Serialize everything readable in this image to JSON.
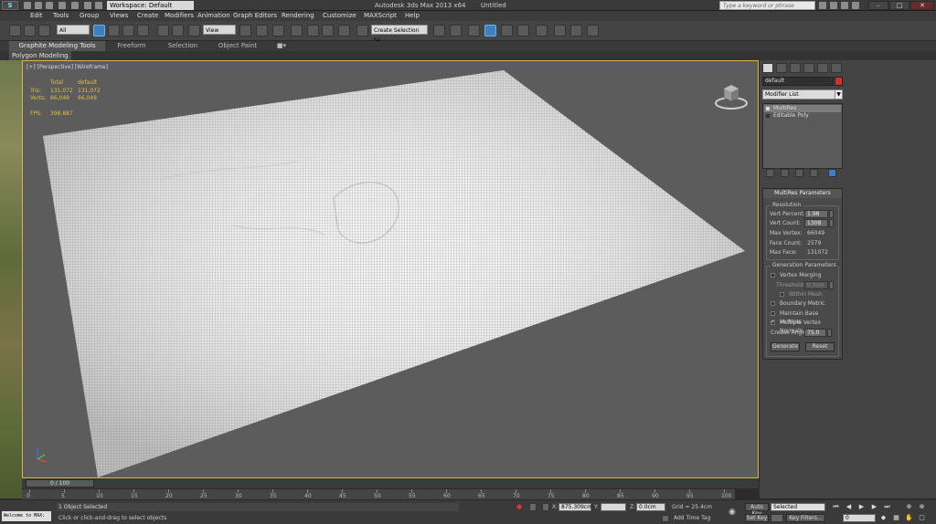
{
  "titlebar": {
    "workspace": "Workspace: Default",
    "app_title": "Autodesk 3ds Max  2013 x64",
    "doc_title": "Untitled",
    "search_placeholder": "Type a keyword or phrase",
    "logo_glyph": "S"
  },
  "menu": {
    "items": [
      "Edit",
      "Tools",
      "Group",
      "Views",
      "Create",
      "Modifiers",
      "Animation",
      "Graph Editors",
      "Rendering",
      "Customize",
      "MAXScript",
      "Help"
    ]
  },
  "toolbar": {
    "selection_filter": "All",
    "ref_coord": "View",
    "named_selection": "Create Selection Se"
  },
  "ribbon": {
    "tabs": [
      "Graphite Modeling Tools",
      "Freeform",
      "Selection",
      "Object Paint"
    ],
    "sub_tab": "Polygon Modeling"
  },
  "viewport": {
    "label": "[+] [Perspective] [Wireframe]",
    "stats": {
      "col_total": "Total",
      "col_default": "default",
      "tris_label": "Tris:",
      "tris_total": "131,072",
      "tris_default": "131,072",
      "verts_label": "Verts:",
      "verts_total": "66,049",
      "verts_default": "66,049",
      "fps_label": "FPS:",
      "fps_value": "398.887"
    }
  },
  "command_panel": {
    "object_name": "default",
    "object_color": "#d32f2f",
    "modifier_list": "Modifier List",
    "stack": [
      "MultiRes",
      "Editable Poly"
    ],
    "rollout_title": "MultiRes Parameters",
    "resolution": {
      "group": "Resolution",
      "vert_percent_label": "Vert Percent:",
      "vert_percent": "1.98",
      "vert_count_label": "Vert Count:",
      "vert_count": "1308",
      "max_vertex_label": "Max Vertex:",
      "max_vertex": "66049",
      "face_count_label": "Face Count:",
      "face_count": "2579",
      "max_face_label": "Max Face:",
      "max_face": "131072"
    },
    "generation": {
      "group": "Generation Parameters",
      "vertex_merging": "Vertex Merging",
      "threshold_label": "Threshold:",
      "threshold": "0.0cm",
      "within_mesh": "Within Mesh",
      "boundary_metric": "Boundary Metric",
      "maintain_base": "Maintain Base Vertices",
      "multiple_normals": "Multiple Vertex Normals",
      "crease_label": "Crease Angle:",
      "crease": "75.0",
      "generate": "Generate",
      "reset": "Reset"
    }
  },
  "timeline": {
    "frame_range": "0 / 100",
    "ticks": [
      "0",
      "5",
      "10",
      "15",
      "20",
      "25",
      "30",
      "35",
      "40",
      "45",
      "50",
      "55",
      "60",
      "65",
      "70",
      "75",
      "80",
      "85",
      "90",
      "95",
      "100"
    ]
  },
  "statusbar": {
    "maxscript": "Welcome to MAX:",
    "objects_selected": "1 Object Selected",
    "prompt": "Click or click-and-drag to select objects",
    "x_label": "X:",
    "x_value": "875.309cm",
    "y_label": "Y:",
    "y_value": "",
    "z_label": "Z:",
    "z_value": "0.0cm",
    "grid": "Grid = 25.4cm",
    "add_time_tag": "Add Time Tag",
    "auto_key": "Auto Key",
    "set_key": "Set Key",
    "selected": "Selected",
    "key_filters": "Key Filters...",
    "frame": "0"
  }
}
